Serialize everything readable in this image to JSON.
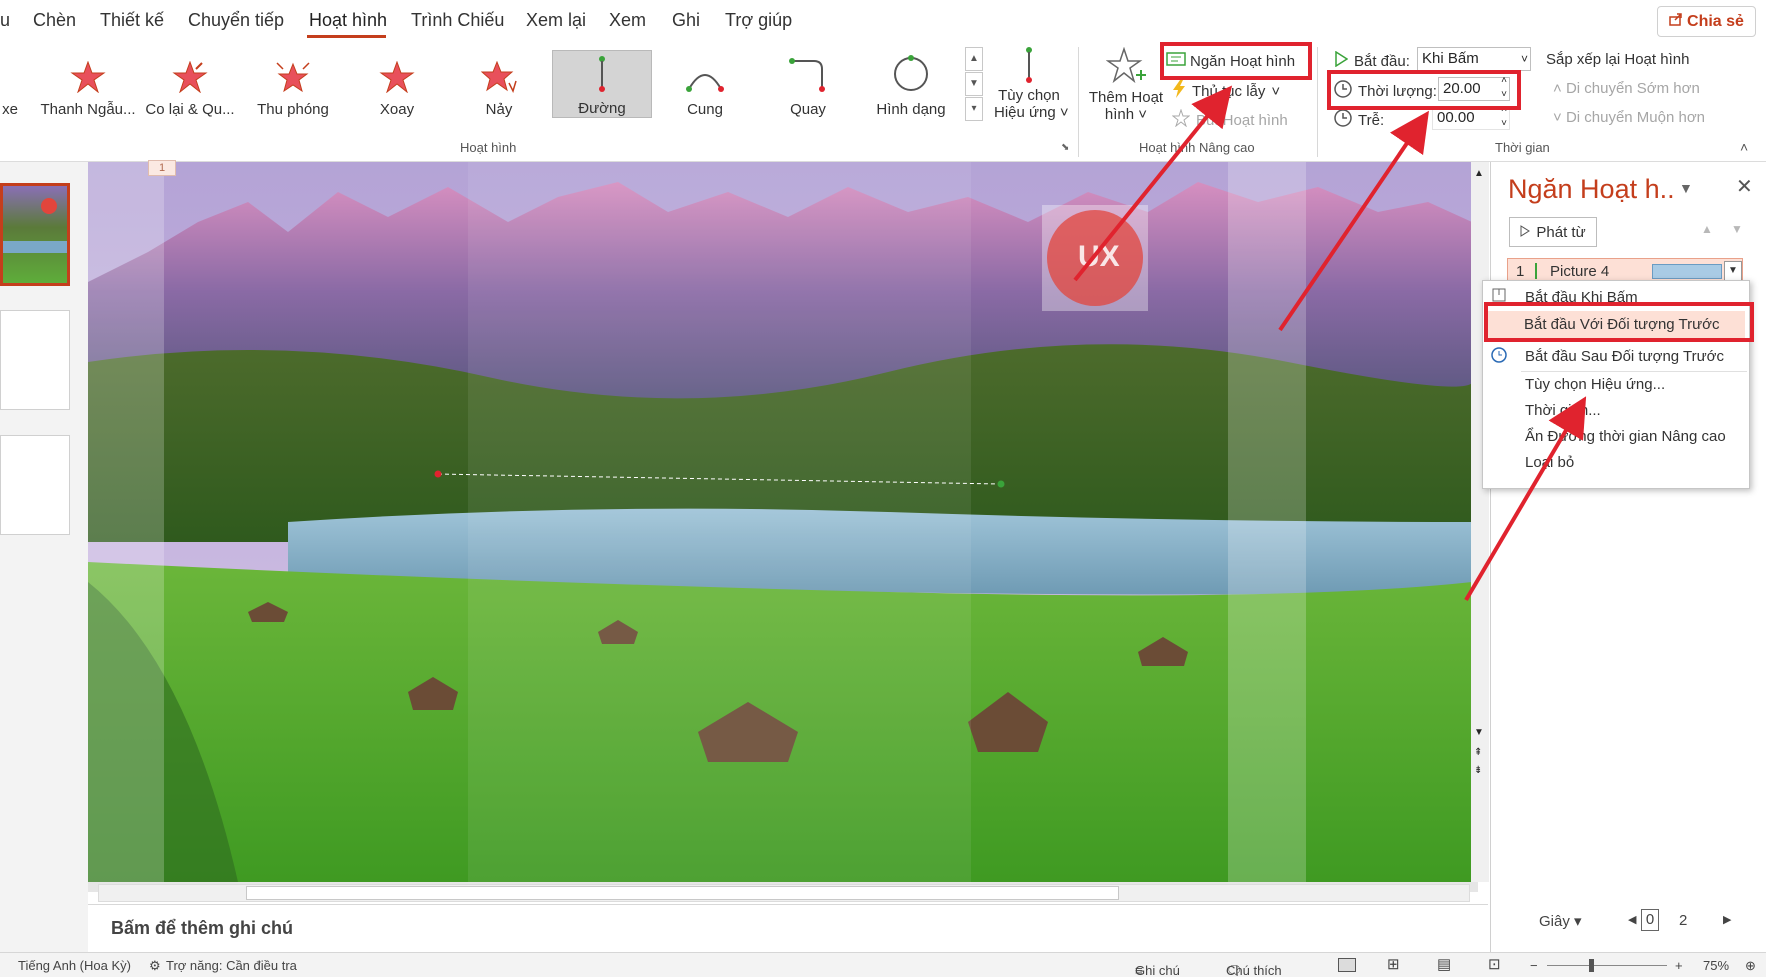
{
  "menu": {
    "tabs": [
      "u",
      "Chèn",
      "Thiết kế",
      "Chuyển tiếp",
      "Hoạt hình",
      "Trình Chiếu",
      "Xem lại",
      "Xem",
      "Ghi",
      "Trợ giúp"
    ],
    "active_tab": "Hoạt hình",
    "share_label": "Chia sẻ"
  },
  "ribbon": {
    "animation_gallery": [
      "xe",
      "Thanh Ngẫu...",
      "Co lại & Qu...",
      "Thu phóng",
      "Xoay",
      "Nảy",
      "Đường",
      "Cung",
      "Quay",
      "Hình dạng"
    ],
    "selected_effect": "Đường",
    "effect_options_line1": "Tùy chọn",
    "effect_options_line2": "Hiệu ứng",
    "group_animation": "Hoạt hình",
    "add_animation_line1": "Thêm Hoạt",
    "add_animation_line2": "hình",
    "animation_pane_button": "Ngăn Hoạt hình",
    "trigger_button": "Thủ tục lẫy",
    "animation_painter": "Bút Hoạt hình",
    "group_advanced": "Hoạt hình Nâng cao",
    "start_label": "Bắt đầu:",
    "start_value": "Khi Bấm",
    "duration_label": "Thời lượng:",
    "duration_value": "20.00",
    "delay_label": "Trễ:",
    "delay_value": "00.00",
    "group_timing": "Thời gian",
    "reorder_title": "Sắp xếp lại Hoạt hình",
    "move_earlier": "Di chuyển Sớm hơn",
    "move_later": "Di chuyển Muộn hơn"
  },
  "slide": {
    "number": "1",
    "logo_text": "UX",
    "notes_placeholder": "Bấm để thêm ghi chú"
  },
  "pane": {
    "title": "Ngăn Hoạt h..",
    "play_from": "Phát từ",
    "item_index": "1",
    "item_name": "Picture 4",
    "context_menu": [
      "Bắt đầu Khi Bấm",
      "Bắt đầu Với Đối tượng Trước",
      "Bắt đầu Sau Đối tượng Trước",
      "Tùy chọn Hiệu ứng...",
      "Thời gian...",
      "Ẩn Đường thời gian Nâng cao",
      "Loại bỏ"
    ],
    "highlighted_item": "Bắt đầu Với Đối tượng Trước",
    "seconds_label": "Giây",
    "timeline_start": "0",
    "timeline_end": "2"
  },
  "status": {
    "language": "Tiếng Anh (Hoa Kỳ)",
    "accessibility": "Trợ năng: Cần điều tra",
    "notes": "Ghi chú",
    "comments": "Chú thích",
    "zoom": "75%"
  },
  "colors": {
    "accent": "#c43e1c",
    "annotation_red": "#e0232e",
    "highlight": "#fde0d6"
  }
}
